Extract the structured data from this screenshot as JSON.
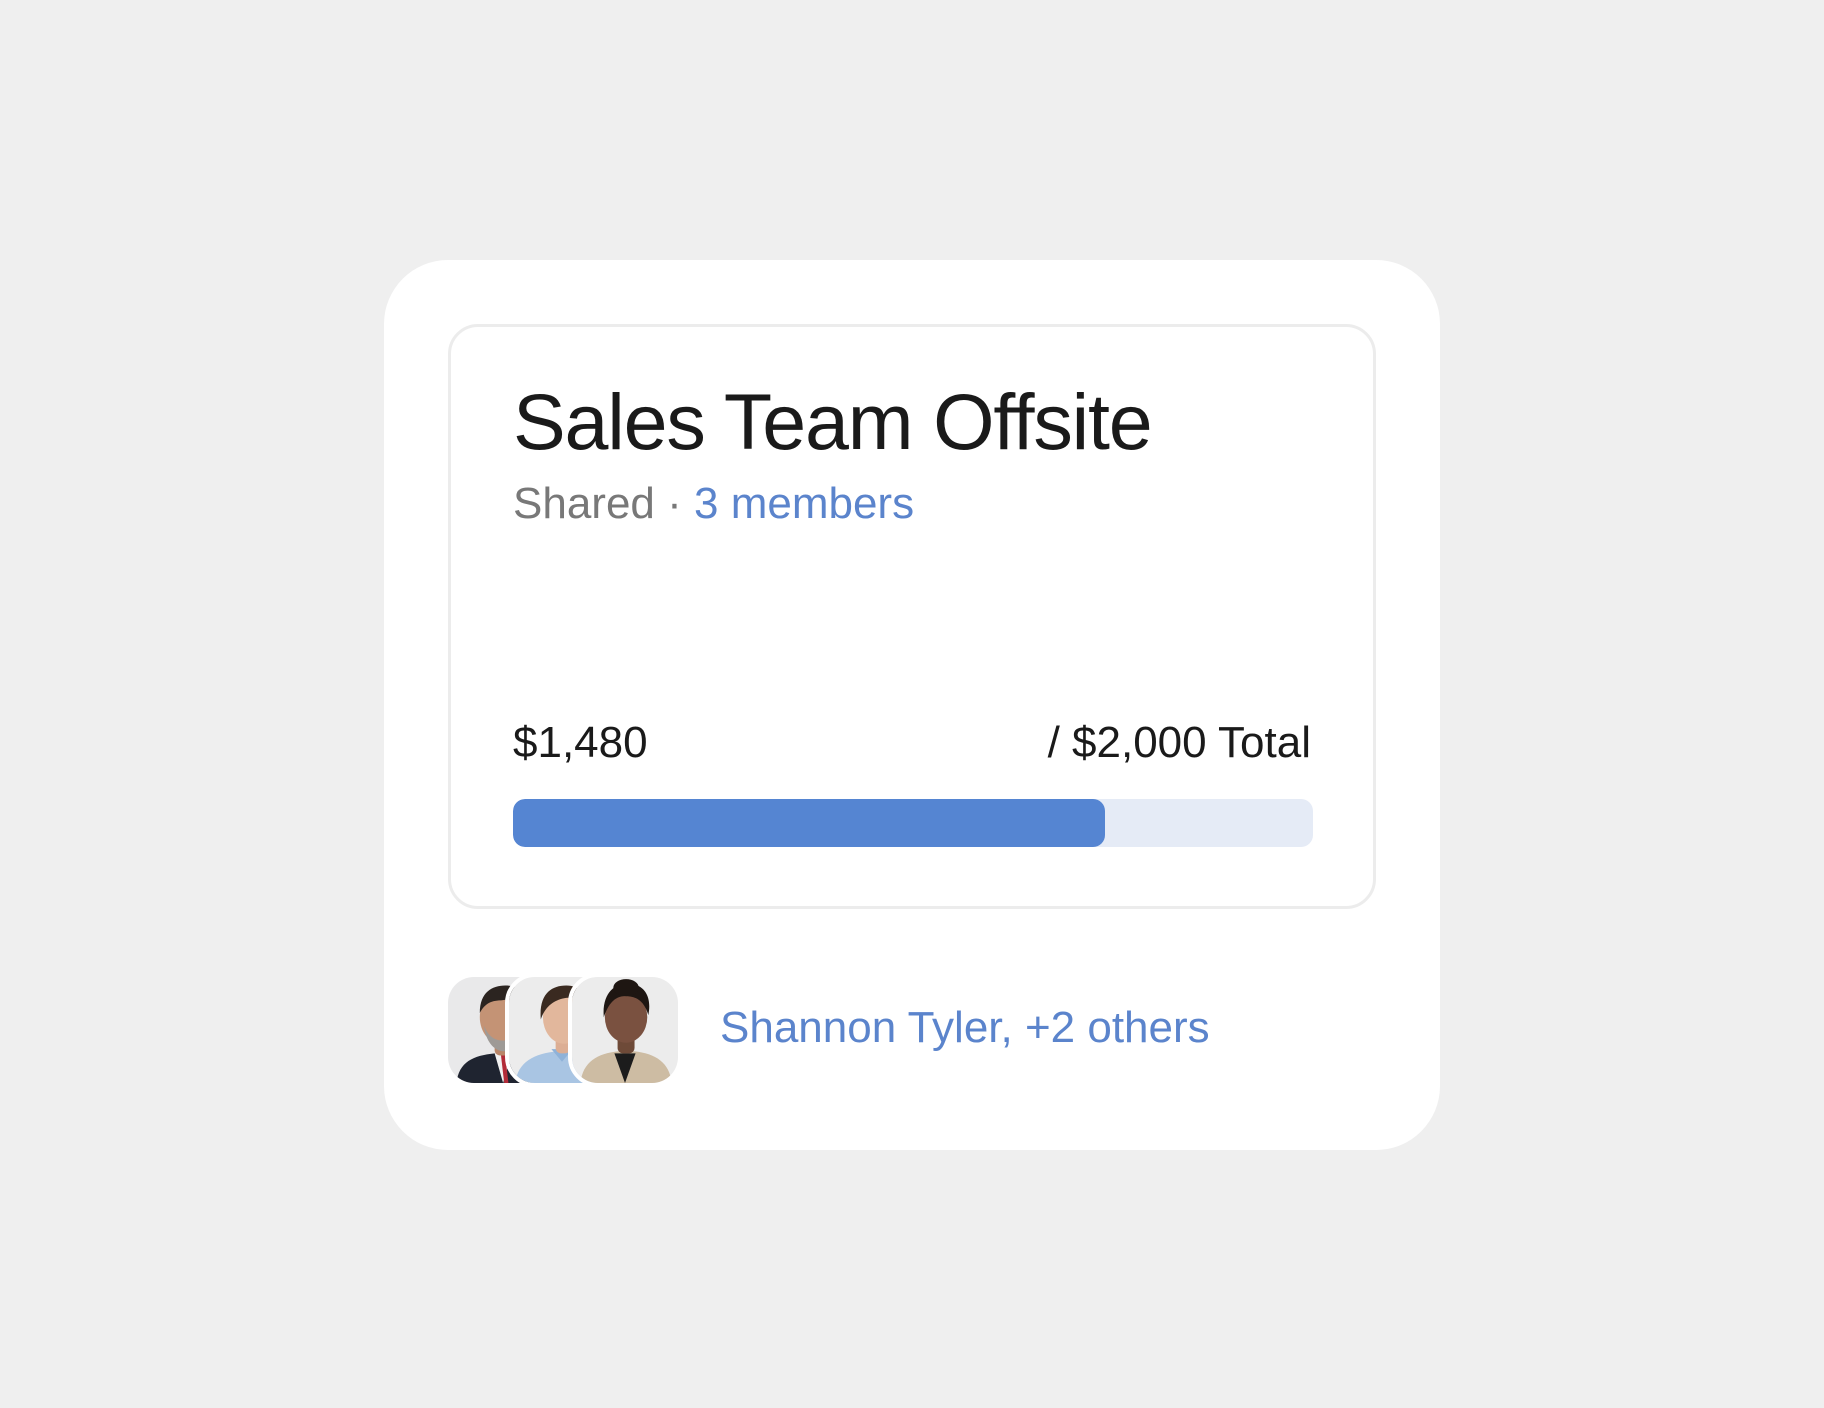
{
  "card": {
    "title": "Sales Team Offsite",
    "status": "Shared",
    "separator": "·",
    "members_link": "3 members"
  },
  "budget": {
    "spent_label": "$1,480",
    "total_label": "/ $2,000 Total",
    "spent": 1480,
    "total": 2000,
    "bar_color": "#5585d2",
    "track_color": "#e5ebf6"
  },
  "members": {
    "summary": "Shannon Tyler, +2 others",
    "avatars": [
      "avatar-older-man",
      "avatar-woman-blue-shirt",
      "avatar-woman-beige-jacket"
    ]
  },
  "colors": {
    "accent": "#5b84cc",
    "background": "#efefef"
  }
}
